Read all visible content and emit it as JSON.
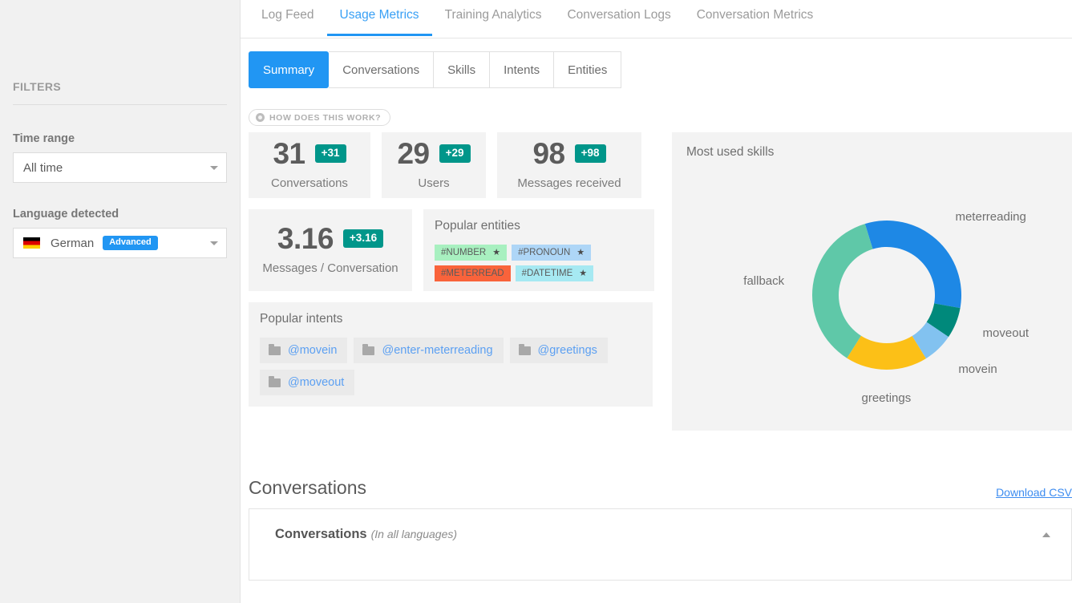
{
  "sidebar": {
    "title": "FILTERS",
    "filters": [
      {
        "label": "Time range",
        "value": "All time",
        "icon": null,
        "badge": null
      },
      {
        "label": "Language detected",
        "value": "German",
        "icon": "german-flag-icon",
        "badge": "Advanced"
      }
    ]
  },
  "top_tabs": [
    {
      "label": "Log Feed",
      "active": false
    },
    {
      "label": "Usage Metrics",
      "active": true
    },
    {
      "label": "Training Analytics",
      "active": false
    },
    {
      "label": "Conversation Logs",
      "active": false
    },
    {
      "label": "Conversation Metrics",
      "active": false
    }
  ],
  "sub_tabs": [
    {
      "label": "Summary",
      "active": true
    },
    {
      "label": "Conversations",
      "active": false
    },
    {
      "label": "Skills",
      "active": false
    },
    {
      "label": "Intents",
      "active": false
    },
    {
      "label": "Entities",
      "active": false
    }
  ],
  "how_it_works": "HOW DOES THIS WORK?",
  "stats": [
    {
      "value": "31",
      "delta": "+31",
      "label": "Conversations"
    },
    {
      "value": "29",
      "delta": "+29",
      "label": "Users"
    },
    {
      "value": "98",
      "delta": "+98",
      "label": "Messages received"
    },
    {
      "value": "3.16",
      "delta": "+3.16",
      "label": "Messages / Conversation"
    }
  ],
  "popular_entities": {
    "title": "Popular entities",
    "tags": [
      {
        "label": "#NUMBER",
        "color": "#a8f0c0",
        "starred": true
      },
      {
        "label": "#PRONOUN",
        "color": "#aed6f7",
        "starred": true
      },
      {
        "label": "#METERREAD",
        "color": "#f9633b",
        "starred": false
      },
      {
        "label": "#DATETIME",
        "color": "#a6e9f2",
        "starred": true
      }
    ],
    "star_glyph": "★"
  },
  "popular_intents": {
    "title": "Popular intents",
    "items": [
      {
        "label": "@movein"
      },
      {
        "label": "@enter-meterreading"
      },
      {
        "label": "@greetings"
      },
      {
        "label": "@moveout"
      }
    ]
  },
  "chart_data": {
    "type": "pie",
    "title": "Most used skills",
    "donut": true,
    "labels": [
      "meterreading",
      "moveout",
      "movein",
      "greetings",
      "fallback"
    ],
    "values": [
      32.5,
      6.7,
      6.7,
      17.8,
      36.3
    ],
    "colors": [
      "#1e88e5",
      "#00897b",
      "#82c2f0",
      "#fcc017",
      "#5fc8a8"
    ],
    "legend": "labels-outside",
    "start_angle_deg": -17
  },
  "bottom": {
    "title": "Conversations",
    "download_link": "Download CSV",
    "panel_title": "Conversations",
    "panel_subtitle": "(In all languages)"
  }
}
